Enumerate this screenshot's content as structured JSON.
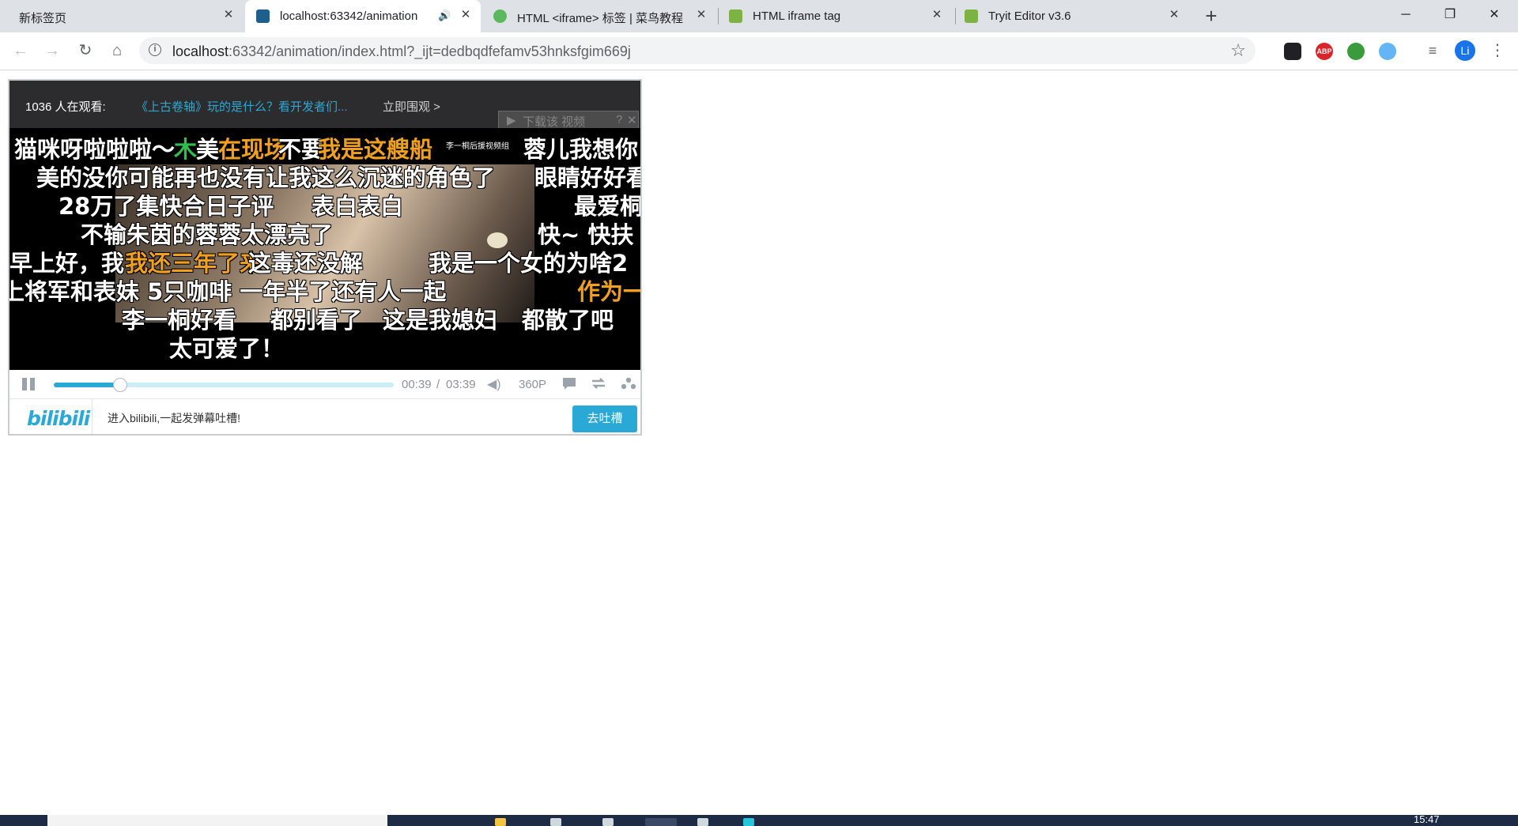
{
  "browser": {
    "tabs": [
      {
        "title": "新标签页",
        "active": false
      },
      {
        "title": "localhost:63342/animation",
        "active": true,
        "audio": true
      },
      {
        "title": "HTML <iframe> 标签 | 菜鸟教程",
        "active": false
      },
      {
        "title": "HTML iframe tag",
        "active": false
      },
      {
        "title": "Tryit Editor v3.6",
        "active": false
      }
    ],
    "close_glyph": "✕",
    "new_tab_glyph": "+",
    "window_controls": {
      "minimize": "─",
      "restore": "❐",
      "close": "✕"
    },
    "address": {
      "url_host": "localhost",
      "url_rest": ":63342/animation/index.html?_ijt=dedbqdfefamv53hnksfgim669j"
    },
    "profile_initial": "Li",
    "extensions": [
      {
        "name": "ghostery-icon",
        "color": "#202124"
      },
      {
        "name": "adblock-plus-icon",
        "color": "#d9242b",
        "label": "ABP"
      },
      {
        "name": "globe-extension-icon",
        "color": "#3a9b3d"
      },
      {
        "name": "translate-extension-icon",
        "color": "#64b5f6"
      }
    ]
  },
  "player": {
    "viewer_count": "1036 人在观看:",
    "promo_link": "《上古卷轴》玩的是什么？看开发者们...",
    "watch_now": "立即围观 >",
    "download_tip": "下载该 视频",
    "danmaku": [
      {
        "text": "猫咪呀啦啦啦～",
        "color": "white"
      },
      {
        "text": "木",
        "color": "green"
      },
      {
        "text": "美",
        "color": "white"
      },
      {
        "text": "在现场",
        "color": "orange"
      },
      {
        "text": "不要",
        "color": "white"
      },
      {
        "text": "我是这艘船",
        "color": "orange"
      },
      {
        "text": "蓉儿我想你",
        "color": "white"
      },
      {
        "text": "美的没你可能再也没有让我这么沉迷的角色了",
        "color": "white"
      },
      {
        "text": "眼睛好好看",
        "color": "white"
      },
      {
        "text": "28万了集快合日子评",
        "color": "white"
      },
      {
        "text": "表白表白",
        "color": "white"
      },
      {
        "text": "最爱桐",
        "color": "white"
      },
      {
        "text": "不输朱茵的蓉蓉太漂亮了",
        "color": "white"
      },
      {
        "text": "快~ 快扶",
        "color": "white"
      },
      {
        "text": "早上好，我",
        "color": "white"
      },
      {
        "text": "我还三年了来",
        "color": "orange"
      },
      {
        "text": "这毒还没解",
        "color": "white"
      },
      {
        "text": "我是一个女的为啥2",
        "color": "white"
      },
      {
        "text": "上将军和表妹 5只咖啡 一年半了还有人一起",
        "color": "white"
      },
      {
        "text": "作为一",
        "color": "orange"
      },
      {
        "text": "李一桐好看",
        "color": "white"
      },
      {
        "text": "都别看了",
        "color": "white"
      },
      {
        "text": "这是我媳妇",
        "color": "white"
      },
      {
        "text": "都散了吧",
        "color": "white"
      },
      {
        "text": "太可爱了！",
        "color": "white"
      },
      {
        "text": "李一桐后援视频组",
        "color": "white"
      }
    ],
    "progress_fraction": 0.1965,
    "time_current": "00:39",
    "time_sep": "/",
    "time_total": "03:39",
    "quality": "360P",
    "logo_text": "bilibili",
    "comment_prompt": "进入bilibili,一起发弹幕吐槽!",
    "send_button": "去吐槽"
  },
  "taskbar": {
    "clock": "15:47"
  },
  "colors": {
    "accent": "#2aa8d6",
    "danmaku_orange": "#f0a020",
    "danmaku_green": "#2fbf4a"
  }
}
